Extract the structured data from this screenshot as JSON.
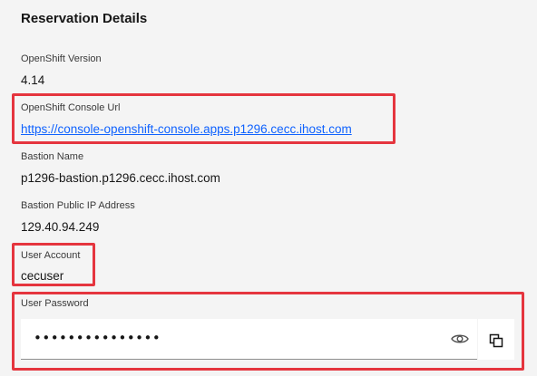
{
  "panel": {
    "title": "Reservation Details"
  },
  "fields": {
    "openshift_version": {
      "label": "OpenShift Version",
      "value": "4.14"
    },
    "console_url": {
      "label": "OpenShift Console Url",
      "value": "https://console-openshift-console.apps.p1296.cecc.ihost.com"
    },
    "bastion_name": {
      "label": "Bastion Name",
      "value": "p1296-bastion.p1296.cecc.ihost.com"
    },
    "bastion_ip": {
      "label": "Bastion Public IP Address",
      "value": "129.40.94.249"
    },
    "user_account": {
      "label": "User Account",
      "value": "cecuser"
    },
    "user_password": {
      "label": "User Password",
      "masked_value": "•••••••••••••••"
    }
  },
  "icons": {
    "show_password": "eye-icon",
    "copy": "copy-icon"
  },
  "colors": {
    "highlight": "#e5353e",
    "link": "#0f62fe",
    "background": "#f4f4f4",
    "field_background": "#ffffff"
  }
}
